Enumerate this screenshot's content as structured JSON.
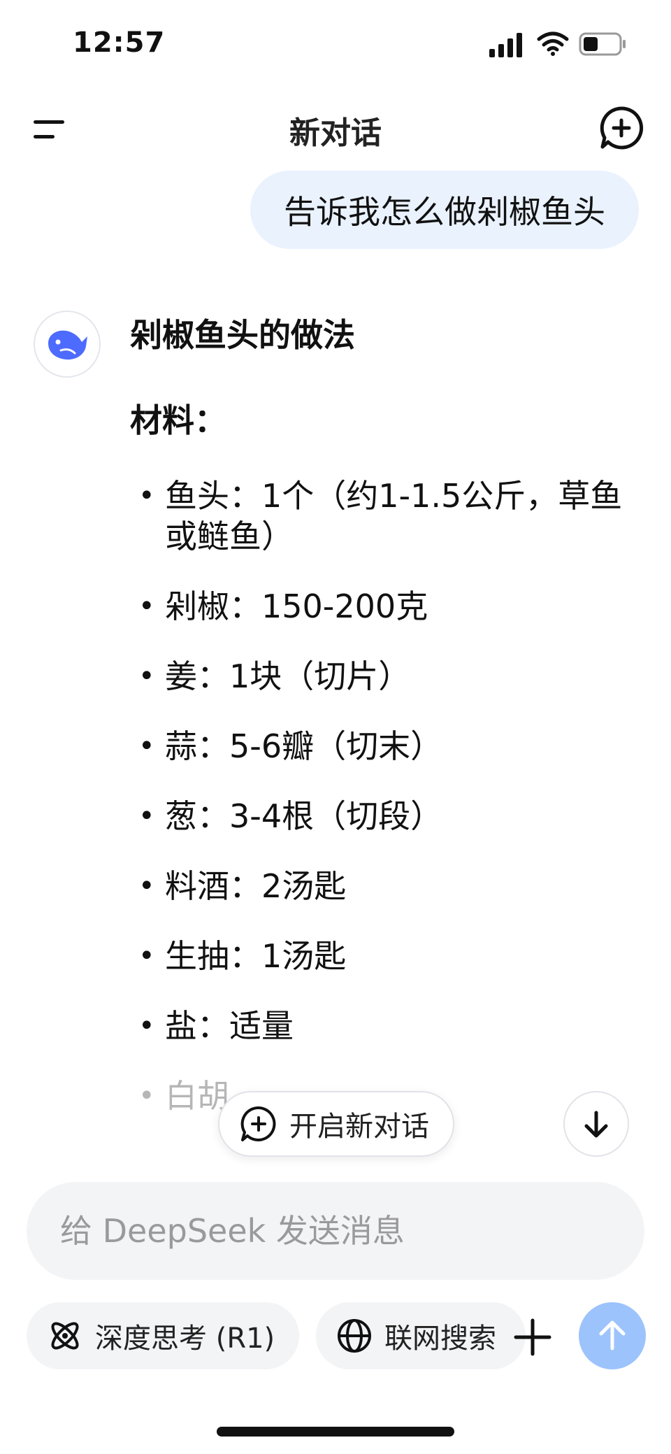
{
  "status_bar": {
    "time": "12:57"
  },
  "header": {
    "title": "新对话"
  },
  "user_message": "告诉我怎么做剁椒鱼头",
  "answer": {
    "title": "剁椒鱼头的做法",
    "section_label": "材料：",
    "ingredients": [
      "鱼头：1个（约1-1.5公斤，草鱼或鲢鱼）",
      "剁椒：150-200克",
      "姜：1块（切片）",
      "蒜：5-6瓣（切末）",
      "葱：3-4根（切段）",
      "料酒：2汤匙",
      "生抽：1汤匙",
      "盐：适量",
      "白胡"
    ]
  },
  "floating": {
    "new_chat_label": "开启新对话"
  },
  "composer": {
    "placeholder": "给 DeepSeek 发送消息",
    "deep_think_label": "深度思考 (R1)",
    "web_search_label": "联网搜索"
  },
  "colors": {
    "accent": "#4d6bfe",
    "user_bubble": "#eaf2fe",
    "send_button": "#9cc3fb"
  }
}
